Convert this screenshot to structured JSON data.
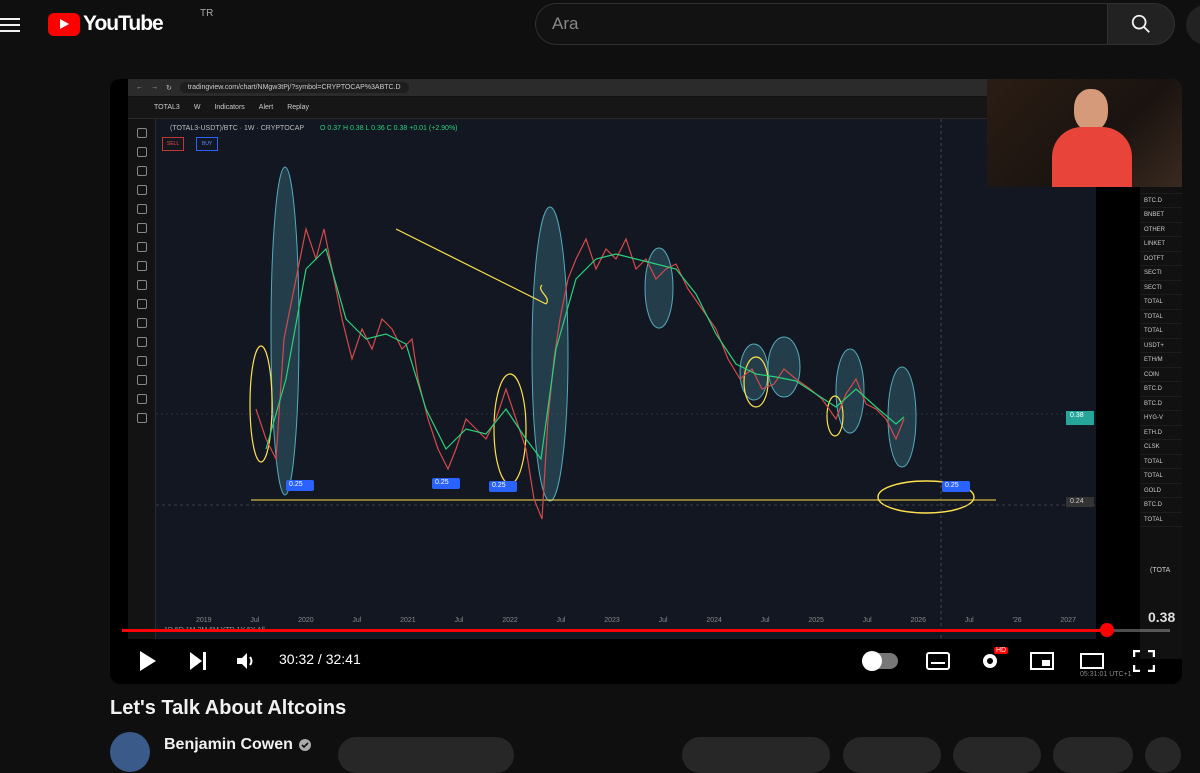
{
  "header": {
    "logo_text": "YouTube",
    "country_code": "TR",
    "search_placeholder": "Ara"
  },
  "browser": {
    "url": "tradingview.com/chart/NMgw3tPj/?symbol=CRYPTOCAP%3ABTC.D"
  },
  "tradingview": {
    "symbol": "TOTAL3",
    "interval": "W",
    "indicators_label": "Indicators",
    "alert_label": "Alert",
    "replay_label": "Replay",
    "legend": "(TOTAL3-USDT)/BTC · 1W · CRYPTOCAP",
    "ohlc": "O 0.37  H 0.38  L 0.36  C 0.38  +0.01 (+2.90%)",
    "sell_label": "SELL",
    "buy_label": "BUY",
    "x_axis": [
      "2019",
      "Jul",
      "2020",
      "Jul",
      "2021",
      "Jul",
      "2022",
      "Jul",
      "2023",
      "Jul",
      "2024",
      "Jul",
      "2025",
      "Jul",
      "2026",
      "Jul",
      "'26",
      "2027"
    ],
    "price_label_1": "0.38",
    "price_label_2": "0.24",
    "level_tags": [
      "0.25",
      "0.25",
      "0.25",
      "0.25"
    ],
    "timeframes": "1D 5D 1M 3M 6M YTD 1Y 5Y All",
    "clock": "05:31:01 UTC+1",
    "watchlist": [
      "OTHER",
      "BTC.D",
      "BNBET",
      "OTHER",
      "LINKET",
      "DOTFT",
      "SECTI",
      "SECTI",
      "TOTAL",
      "TOTAL",
      "TOTAL",
      "USDT+",
      "ETH/M",
      "COIN",
      "BTC.D",
      "BTC.D",
      "HYG-V",
      "ETH.D",
      "CLSK",
      "TOTAL",
      "TOTAL",
      "GOLD",
      "BTC.D",
      "TOTAL"
    ],
    "side_price": "0.38",
    "side_symbol": "(TOTA"
  },
  "player": {
    "current_time": "30:32",
    "duration": "32:41",
    "time_separator": " / ",
    "progress_fraction": 0.94
  },
  "video": {
    "title": "Let's Talk About Altcoins",
    "channel": "Benjamin Cowen"
  }
}
